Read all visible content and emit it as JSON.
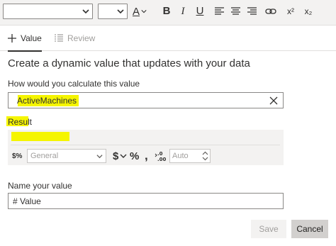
{
  "toolbar": {
    "font_family_value": "",
    "font_size_value": "",
    "font_color_glyph": "A",
    "bold_glyph": "B",
    "italic_glyph": "I",
    "underline_glyph": "U",
    "superscript_glyph": "x²",
    "subscript_glyph": "x₂"
  },
  "tabs": [
    {
      "label": "Value",
      "icon": "plus-icon",
      "active": true
    },
    {
      "label": "Review",
      "icon": "list-icon",
      "active": false
    }
  ],
  "heading": "Create a dynamic value that updates with your data",
  "calc": {
    "label": "How would you calculate this value",
    "value": "ActiveMachines"
  },
  "result": {
    "label": "Result",
    "value": ""
  },
  "format": {
    "format_icon_glyph": "$%",
    "type_value": "General",
    "currency_glyph": "$",
    "percent_glyph": "%",
    "comma_glyph": ",",
    "decimals_value": "Auto"
  },
  "name": {
    "label": "Name your value",
    "value": "# Value"
  },
  "buttons": {
    "save": "Save",
    "cancel": "Cancel"
  },
  "colors": {
    "highlight": "#f5f500",
    "border": "#8a8886",
    "panel": "#f3f2f1"
  }
}
